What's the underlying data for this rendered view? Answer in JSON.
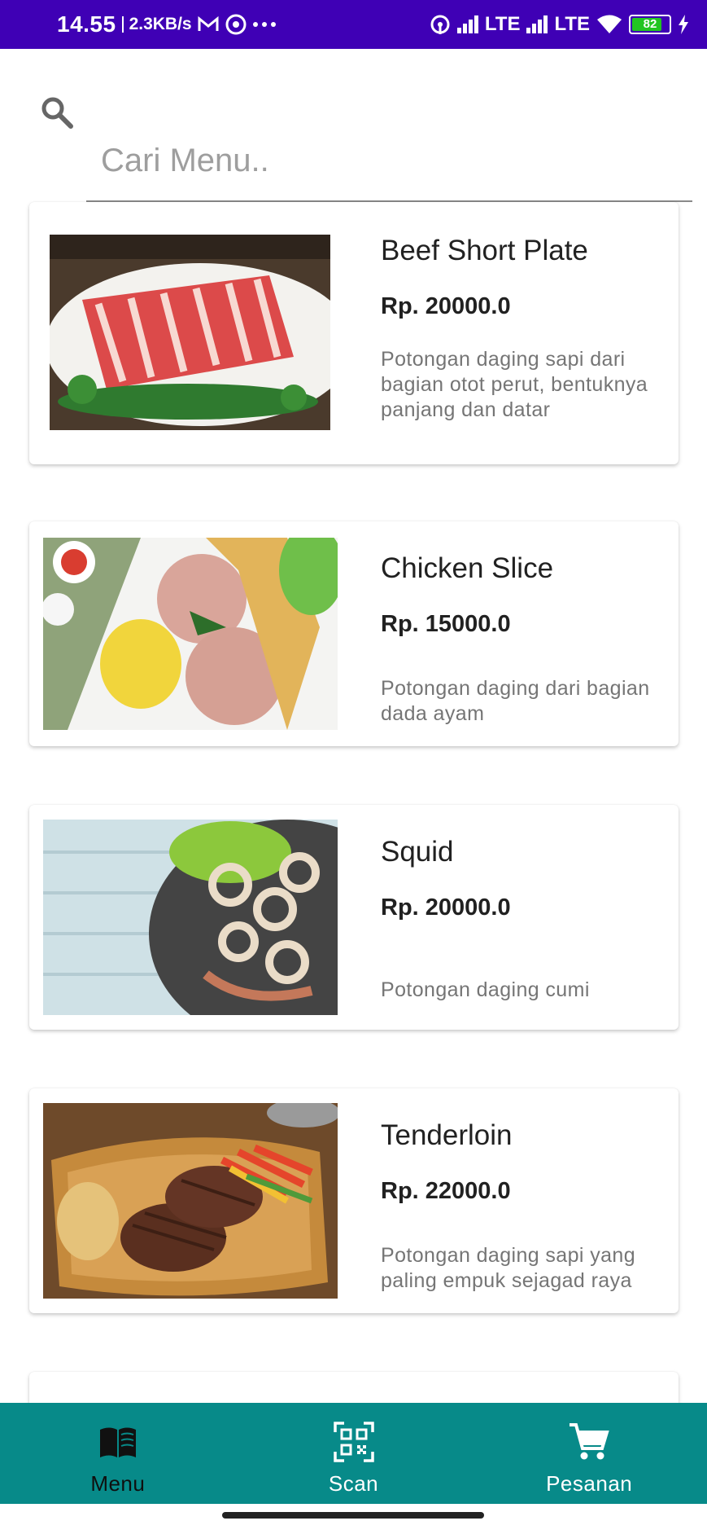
{
  "status_bar": {
    "time": "14.55",
    "net_speed": "2.3KB/s",
    "network_1": "LTE",
    "network_2": "LTE",
    "battery": "82",
    "colors": {
      "background": "#3f00b5",
      "battery": "#22c522"
    }
  },
  "search": {
    "placeholder": "Cari Menu..",
    "value": "",
    "icon": "search-icon"
  },
  "menu_items": [
    {
      "name": "Beef Short Plate",
      "price": "Rp. 20000.0",
      "description": "Potongan daging sapi dari bagian otot perut, bentuknya panjang dan datar"
    },
    {
      "name": "Chicken Slice",
      "price": "Rp. 15000.0",
      "description": "Potongan daging dari bagian dada ayam"
    },
    {
      "name": "Squid",
      "price": "Rp. 20000.0",
      "description": "Potongan daging cumi"
    },
    {
      "name": "Tenderloin",
      "price": "Rp. 22000.0",
      "description": "Potongan daging sapi yang paling empuk sejagad raya"
    }
  ],
  "bottom_nav": {
    "active": "Menu",
    "items": [
      {
        "label": "Menu",
        "icon": "book-icon"
      },
      {
        "label": "Scan",
        "icon": "qr-scan-icon"
      },
      {
        "label": "Pesanan",
        "icon": "cart-icon"
      }
    ],
    "colors": {
      "background": "#078a89",
      "active_label": "#0f0f0f",
      "inactive": "#ffffff"
    }
  }
}
